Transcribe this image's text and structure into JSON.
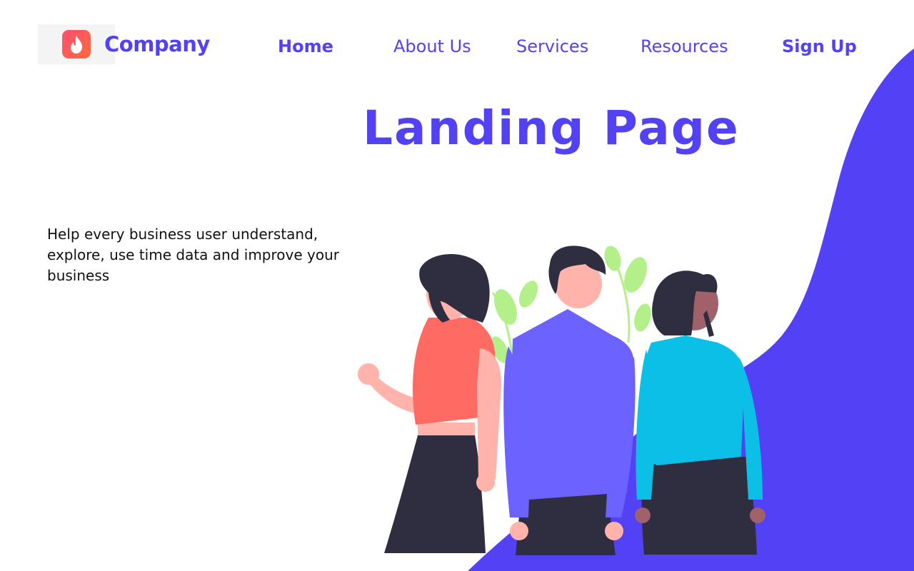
{
  "header": {
    "brand_name": "Company",
    "logo_icon": "flame-icon",
    "nav": {
      "home": "Home",
      "about": "About Us",
      "services": "Services",
      "resources": "Resources",
      "signup": "Sign Up"
    }
  },
  "hero": {
    "title": "Landing Page",
    "description": "Help every business user understand, explore, use time data and improve your business",
    "illustration": "three-people-illustration"
  },
  "colors": {
    "accent": "#5341f5",
    "logo_gradient_start": "#ff4f70",
    "logo_gradient_end": "#ff6a3c",
    "shirt_coral": "#ff6b63",
    "shirt_purple": "#6b62ff",
    "shirt_cyan": "#0cbfe6",
    "leaf_green": "#b4f08a",
    "hair_dark": "#2f2e41"
  }
}
